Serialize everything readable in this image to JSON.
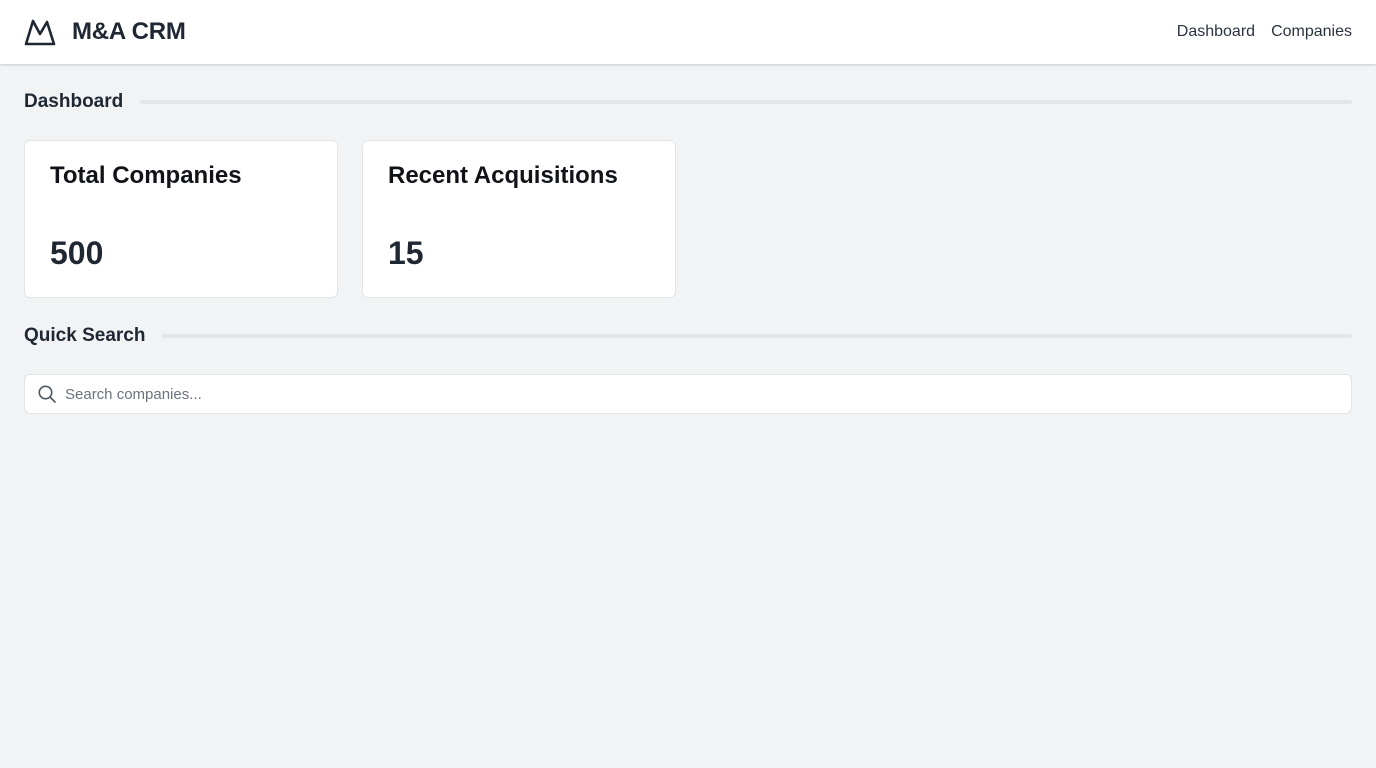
{
  "app": {
    "name": "M&A CRM",
    "logo_icon": "mountain-icon"
  },
  "nav": {
    "items": [
      {
        "label": "Dashboard"
      },
      {
        "label": "Companies"
      }
    ]
  },
  "dashboard": {
    "heading": "Dashboard",
    "cards": [
      {
        "title": "Total Companies",
        "value": "500"
      },
      {
        "title": "Recent Acquisitions",
        "value": "15"
      }
    ]
  },
  "quick_search": {
    "heading": "Quick Search",
    "placeholder": "Search companies...",
    "value": "",
    "icon": "search-icon"
  },
  "colors": {
    "background": "#f2f3f5",
    "surface": "#ffffff",
    "text": "#1f2733",
    "border": "#e3e5e9"
  }
}
